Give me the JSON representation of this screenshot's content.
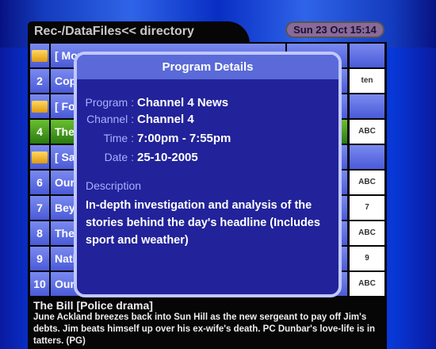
{
  "header": {
    "title": "Rec-/DataFiles<< directory",
    "datetime": "Sun 23 Oct 15:14"
  },
  "rows": [
    {
      "num": "",
      "icon": "folder-icon",
      "name": "[ Mov",
      "logo": ""
    },
    {
      "num": "2",
      "name": "Cop",
      "logo": "ten"
    },
    {
      "num": "",
      "icon": "folder-icon",
      "name": "[ Fo",
      "logo": ""
    },
    {
      "num": "4",
      "name": "The",
      "logo": "ABC",
      "selected": true
    },
    {
      "num": "",
      "icon": "folder-icon",
      "name": "[ Sa",
      "logo": ""
    },
    {
      "num": "6",
      "name": "Our",
      "logo": "ABC"
    },
    {
      "num": "7",
      "name": "Bey",
      "logo": "7"
    },
    {
      "num": "8",
      "name": "The",
      "logo": "ABC"
    },
    {
      "num": "9",
      "name": "Nati",
      "logo": "9"
    },
    {
      "num": "10",
      "name": "Our",
      "logo": "ABC"
    }
  ],
  "modal": {
    "title": "Program Details",
    "program_label": "Program :",
    "program": "Channel 4 News",
    "channel_label": "Channel :",
    "channel": "Channel 4",
    "time_label": "Time :",
    "time": "7:00pm - 7:55pm",
    "date_label": "Date :",
    "date": "25-10-2005",
    "description_label": "Description",
    "description": "In-depth investigation and analysis of the stories behind the day's headline (Includes sport and weather)"
  },
  "info": {
    "title": "The Bill [Police drama]",
    "description": "June Ackland breezes back into Sun Hill as the new sergeant to pay off Jim's debts. Jim beats himself up over his ex-wife's death. PC Dunbar's love-life is in tatters. (PG)"
  },
  "colors": {
    "selected_row": "#3a9a20",
    "row": "#5a6ad8",
    "modal_bg": "#22229a"
  }
}
